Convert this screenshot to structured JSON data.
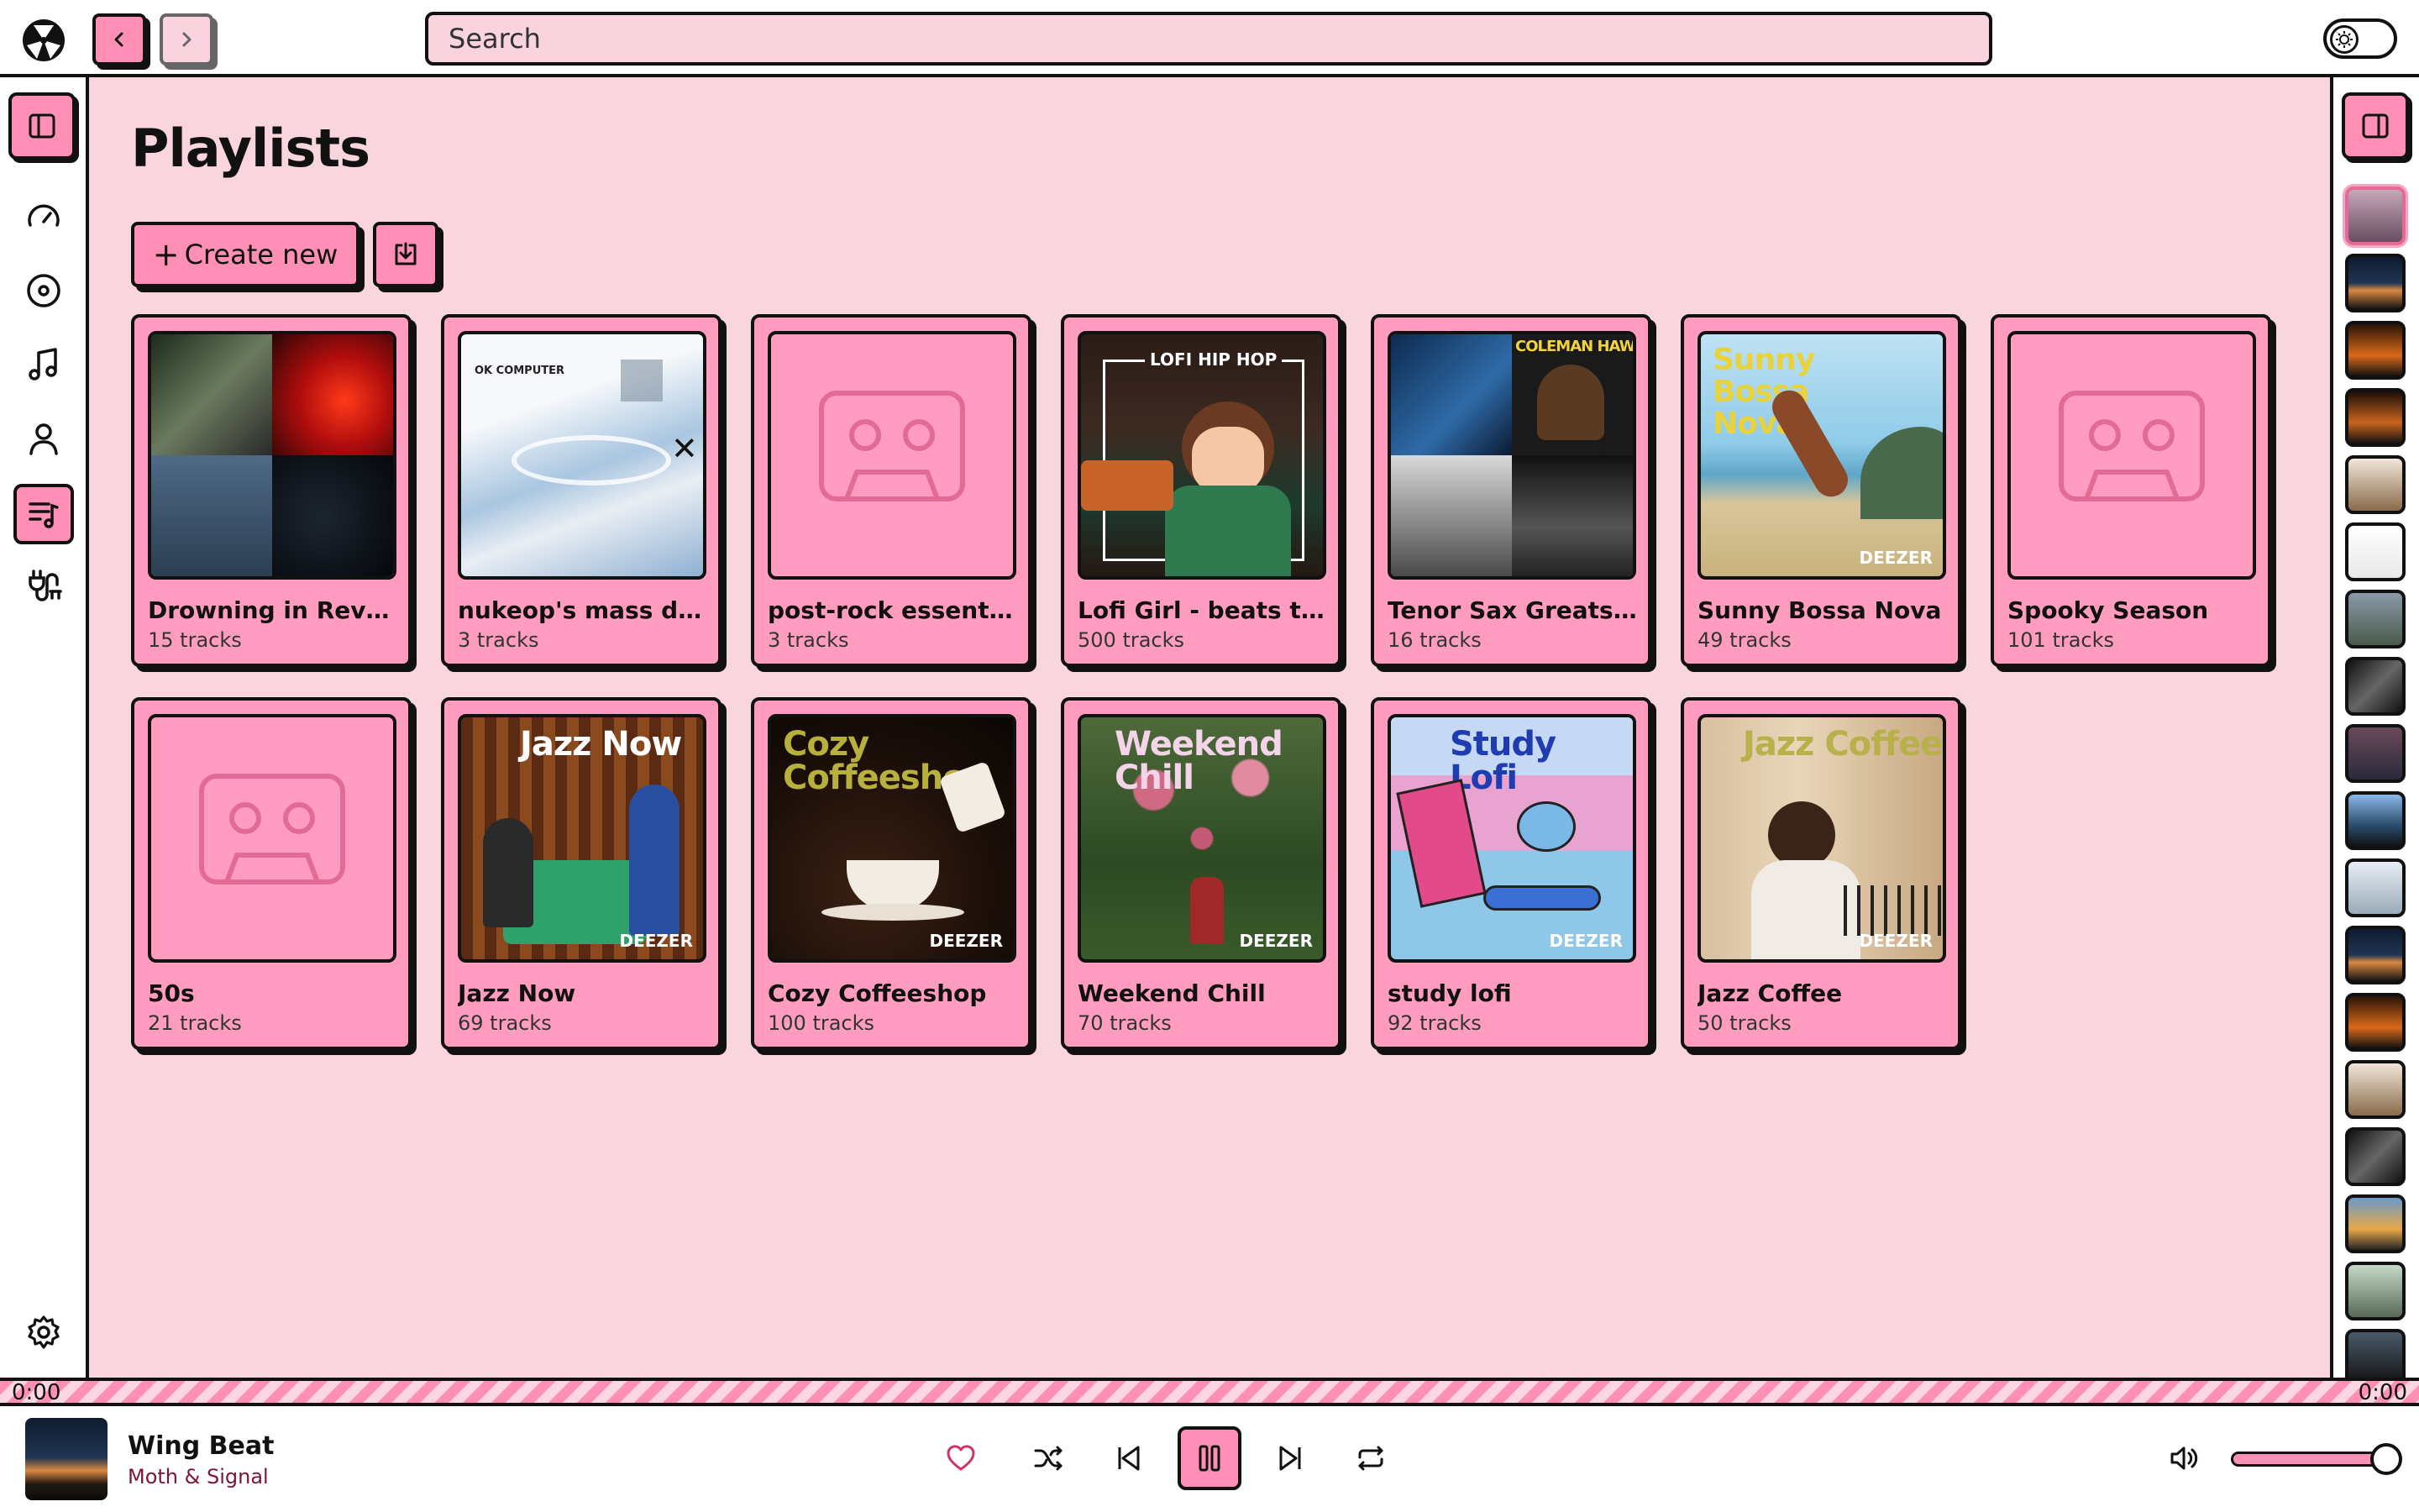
{
  "app": {
    "theme_accent": "#ff8fb6",
    "background": "#f9d5de"
  },
  "search": {
    "placeholder": "Search"
  },
  "page": {
    "title": "Playlists"
  },
  "actions": {
    "create_label": "Create new",
    "create_icon": "plus-icon",
    "import_icon": "import-icon"
  },
  "sidebar": {
    "items": [
      {
        "name": "toggle-sidebar",
        "icon": "panel-left-icon"
      },
      {
        "name": "home",
        "icon": "gauge-icon"
      },
      {
        "name": "albums",
        "icon": "disc-icon"
      },
      {
        "name": "tracks",
        "icon": "music-note-icon"
      },
      {
        "name": "artists",
        "icon": "user-icon"
      },
      {
        "name": "playlists",
        "icon": "playlist-icon",
        "active": true
      },
      {
        "name": "connections",
        "icon": "plug-icon"
      },
      {
        "name": "settings",
        "icon": "gear-icon"
      }
    ]
  },
  "playlists": [
    {
      "name": "Drowning in Reverb ...",
      "count": "15 tracks",
      "art": "collage"
    },
    {
      "name": "nukeop's mass dest...",
      "count": "3 tracks",
      "art": "okcomputer",
      "art_text": "OK COMPUTER"
    },
    {
      "name": "post-rock essentials",
      "count": "3 tracks",
      "art": "placeholder"
    },
    {
      "name": "Lofi Girl - beats to r...",
      "count": "500 tracks",
      "art": "lofi",
      "art_text": "LOFI HIP HOP"
    },
    {
      "name": "Tenor Sax Greats - ...",
      "count": "16 tracks",
      "art": "collage-jazz",
      "art_text": "COLEMAN HAWKINS"
    },
    {
      "name": "Sunny Bossa Nova",
      "count": "49 tracks",
      "art": "bossa",
      "art_text": "Sunny Bossa Nova",
      "brand": "DEEZER"
    },
    {
      "name": "Spooky Season",
      "count": "101 tracks",
      "art": "placeholder"
    },
    {
      "name": "50s",
      "count": "21 tracks",
      "art": "placeholder"
    },
    {
      "name": "Jazz Now",
      "count": "69 tracks",
      "art": "jazznow",
      "art_text": "Jazz Now",
      "brand": "DEEZER"
    },
    {
      "name": "Cozy Coffeeshop",
      "count": "100 tracks",
      "art": "coffee",
      "art_text": "Cozy Coffeeshop",
      "brand": "DEEZER"
    },
    {
      "name": "Weekend Chill",
      "count": "70 tracks",
      "art": "weekend",
      "art_text": "Weekend Chill",
      "brand": "DEEZER"
    },
    {
      "name": "study lofi",
      "count": "92 tracks",
      "art": "study",
      "art_text": "Study Lofi",
      "brand": "DEEZER"
    },
    {
      "name": "Jazz Coffee",
      "count": "50 tracks",
      "art": "jazzcoffee",
      "art_text": "Jazz Coffee",
      "brand": "DEEZER"
    }
  ],
  "queue": {
    "thumb_count": 16
  },
  "progress": {
    "elapsed": "0:00",
    "total": "0:00",
    "fraction": 0
  },
  "player": {
    "track_title": "Wing Beat",
    "artist": "Moth & Signal",
    "state": "playing",
    "volume": 1.0,
    "controls": [
      "heart-icon",
      "shuffle-icon",
      "skip-back-icon",
      "pause-icon",
      "skip-forward-icon",
      "repeat-icon",
      "volume-icon"
    ]
  }
}
